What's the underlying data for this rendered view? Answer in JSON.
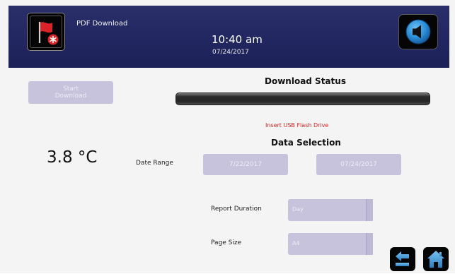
{
  "header": {
    "title": "PDF Download",
    "time": "10:40 am",
    "date": "07/24/2017"
  },
  "colors": {
    "header_bg": "#232863",
    "button_disabled": "#c7c3dc",
    "alert_text": "#e02020",
    "sound_icon": "#2d8fd8",
    "alarm_flag": "#d8232a"
  },
  "left_panel": {
    "start_download_label": [
      "Start",
      "Download"
    ],
    "temperature": "3.8 °C"
  },
  "download_status": {
    "title": "Download Status",
    "progress": 0,
    "message": "Insert USB Flash Drive"
  },
  "data_selection": {
    "title": "Data Selection",
    "date_range_label": "Date Range",
    "start_date": "7/22/2017",
    "end_date": "07/24/2017",
    "report_duration_label": "Report Duration",
    "report_duration_value": "Day",
    "page_size_label": "Page Size",
    "page_size_value": "A4"
  },
  "icons": {
    "alarm": "alarm-flag-icon",
    "sound": "speaker-icon",
    "back": "back-arrow-icon",
    "home": "home-icon"
  }
}
